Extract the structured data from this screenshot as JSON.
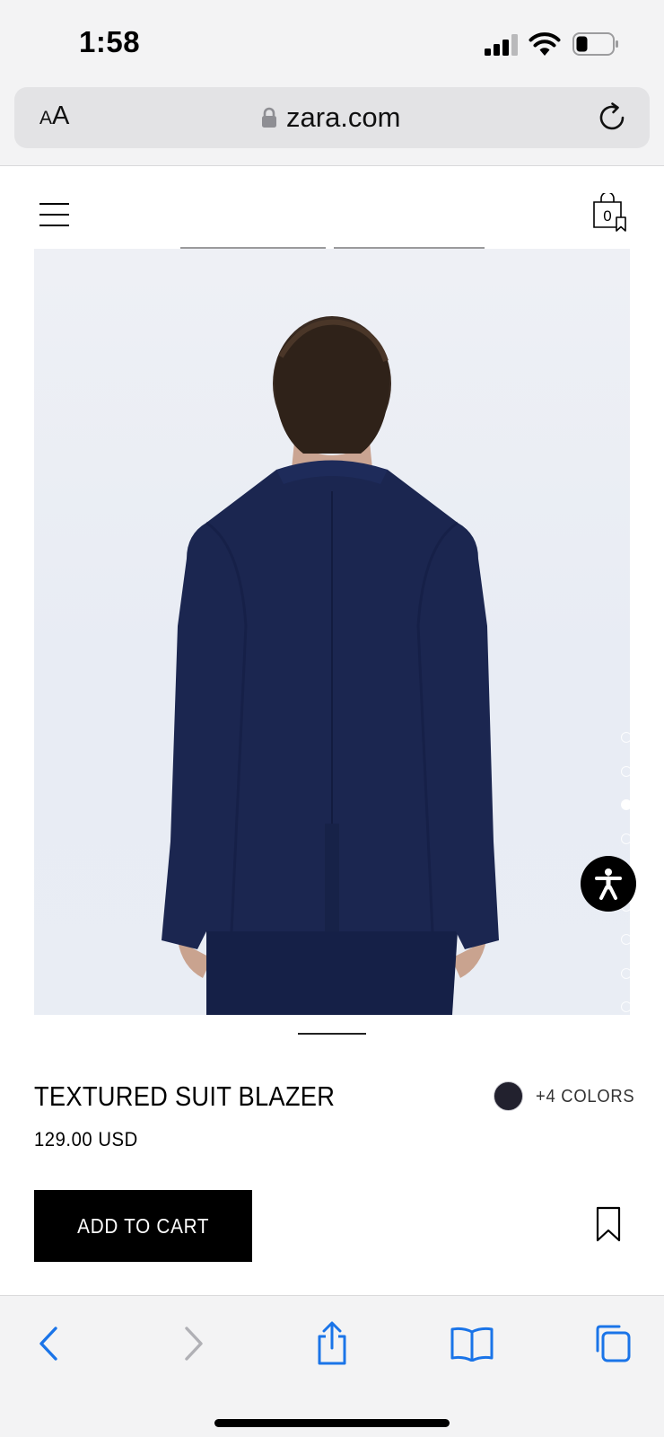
{
  "status_bar": {
    "time": "1:58"
  },
  "browser": {
    "text_size_label": "AA",
    "url": "zara.com"
  },
  "header": {
    "cart_count": "0"
  },
  "product": {
    "gallery": {
      "image_count": 9,
      "active_index": 3
    },
    "title": "TEXTURED SUIT BLAZER",
    "price": "129.00 USD",
    "selected_color_hex": "#22212e",
    "more_colors_label": "+4 COLORS",
    "add_to_cart_label": "ADD TO CART"
  },
  "colors": {
    "accent": "#1a74e8",
    "button_bg": "#000000",
    "blazer": "#1b2650"
  },
  "toolbar": {
    "items": [
      "back-icon",
      "forward-icon",
      "share-icon",
      "bookmarks-icon",
      "tabs-icon"
    ]
  }
}
